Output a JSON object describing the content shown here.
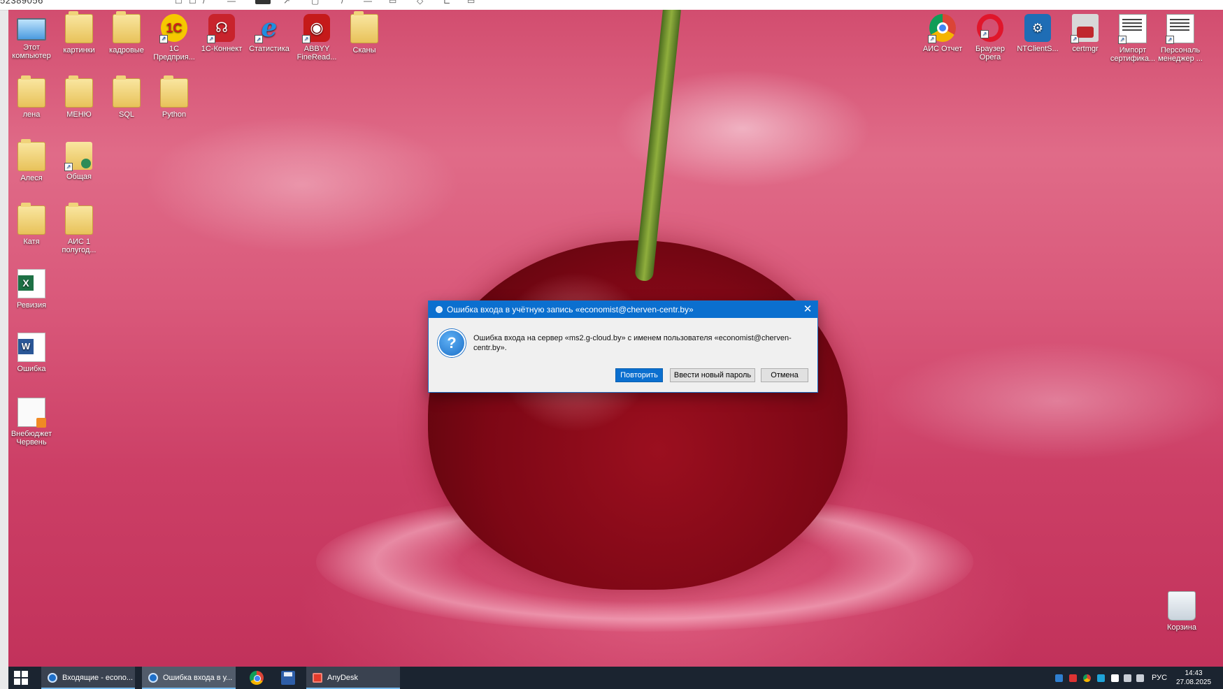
{
  "top_strip": {
    "session_id": "52389056",
    "glyphs": [
      "☐",
      "↗",
      "▢",
      "/",
      "—",
      "▭",
      "◇",
      "⊏",
      "▭"
    ]
  },
  "desktop": {
    "icons_left": [
      {
        "name": "this-computer",
        "label": "Этот компьютер",
        "icon": "computer-icon"
      },
      {
        "name": "kartinki",
        "label": "картинки",
        "icon": "folder-icon"
      },
      {
        "name": "kadrovye",
        "label": "кадровые",
        "icon": "folder-icon"
      },
      {
        "name": "1c-enterprise",
        "label": "1С Предприя...",
        "icon": "1c-icon"
      },
      {
        "name": "1c-konnekt",
        "label": "1С-Коннект",
        "icon": "headset-icon"
      },
      {
        "name": "statistika",
        "label": "Статистика",
        "icon": "ie-icon"
      },
      {
        "name": "abbyy",
        "label": "ABBYY FineRead...",
        "icon": "abbyy-icon"
      },
      {
        "name": "skany",
        "label": "Сканы",
        "icon": "folder-icon"
      },
      {
        "name": "lena",
        "label": "лена",
        "icon": "folder-icon"
      },
      {
        "name": "menu",
        "label": "МЕНЮ",
        "icon": "folder-icon"
      },
      {
        "name": "sql",
        "label": "SQL",
        "icon": "folder-icon"
      },
      {
        "name": "python",
        "label": "Python",
        "icon": "folder-icon"
      },
      {
        "name": "alesya",
        "label": "Алеся",
        "icon": "folder-icon"
      },
      {
        "name": "obshchaya",
        "label": "Общая",
        "icon": "shared-folder-icon"
      },
      {
        "name": "katya",
        "label": "Катя",
        "icon": "folder-icon"
      },
      {
        "name": "ais-1-polugod",
        "label": "АИС 1 полугод...",
        "icon": "folder-icon"
      },
      {
        "name": "reviziya",
        "label": "Ревизия",
        "icon": "excel-icon"
      },
      {
        "name": "oshibka",
        "label": "Ошибка",
        "icon": "word-icon"
      },
      {
        "name": "vnebudzhet",
        "label": "Внебюджет Червень",
        "icon": "document-icon"
      }
    ],
    "icons_right": [
      {
        "name": "ais-otchet",
        "label": "АИС Отчет",
        "icon": "chrome-icon"
      },
      {
        "name": "opera",
        "label": "Браузер Opera",
        "icon": "opera-icon"
      },
      {
        "name": "ntclient",
        "label": "NTClientS...",
        "icon": "ntclient-icon"
      },
      {
        "name": "certmgr",
        "label": "certmgr",
        "icon": "certmgr-icon"
      },
      {
        "name": "import-cert",
        "label": "Импорт сертифика...",
        "icon": "certificate-icon"
      },
      {
        "name": "personal-manager",
        "label": "Персональ менеджер ...",
        "icon": "certificate-icon"
      }
    ],
    "recycle_bin": {
      "label": "Корзина",
      "icon": "recycle-bin-icon"
    }
  },
  "dialog": {
    "title": "Ошибка входа в учётную запись «economist@cherven-centr.by»",
    "message": "Ошибка входа на сервер «ms2.g-cloud.by» с именем пользователя «economist@cherven-centr.by».",
    "buttons": {
      "retry": "Повторить",
      "new_password": "Ввести новый пароль",
      "cancel": "Отмена"
    },
    "close_glyph": "✕",
    "icon": "question-icon",
    "question_glyph": "?"
  },
  "taskbar": {
    "tasks": [
      {
        "name": "task-inbox",
        "label": "Входящие - econo..."
      },
      {
        "name": "task-login-error",
        "label": "Ошибка входа в у..."
      },
      {
        "name": "task-anydesk",
        "label": "AnyDesk"
      }
    ],
    "tray": {
      "language": "РУС",
      "time": "14:43",
      "date": "27.08.2025"
    }
  },
  "colors": {
    "titlebar": "#0b6fcf",
    "taskbar": "#1b2430",
    "accent": "#76b9ed"
  }
}
